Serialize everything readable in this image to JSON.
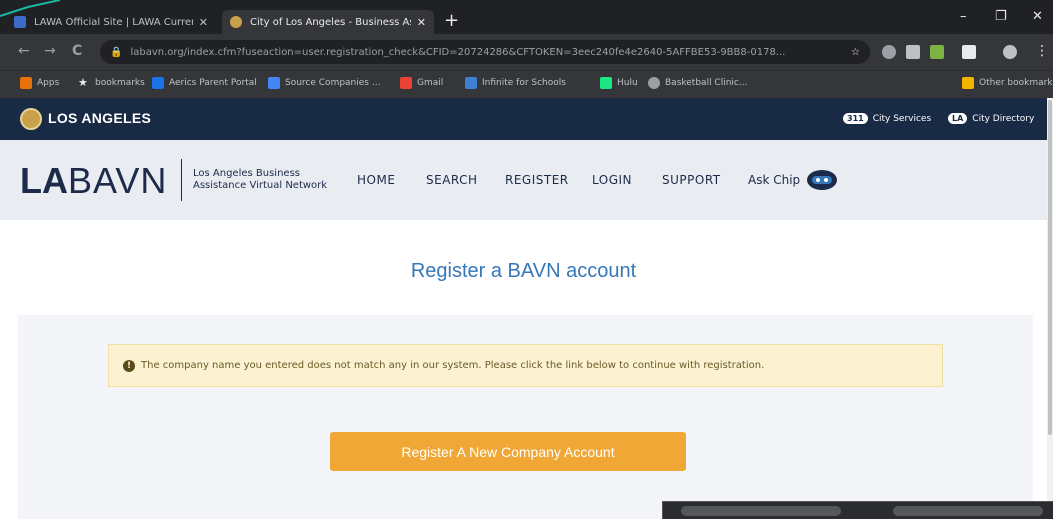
{
  "browser": {
    "tabs": [
      {
        "title": "LAWA Official Site | LAWA Current...",
        "active": false,
        "favicon_color": "#3b6ac9"
      },
      {
        "title": "City of Los Angeles - Business Ass...",
        "active": true,
        "favicon_color": "#c9a14a"
      }
    ],
    "new_tab": "+",
    "window_controls": {
      "minimize": "–",
      "maximize": "❐",
      "close": "✕"
    },
    "nav": {
      "back": "←",
      "forward": "→",
      "reload": "C"
    },
    "url": "labavn.org/index.cfm?fuseaction=user.registration_check&CFID=20724286&CFTOKEN=3eec240fe4e2640-5AFFBE53-9BB8-0178...",
    "bookmarks": [
      {
        "label": "Apps",
        "color": "#e8710a"
      },
      {
        "label": "bookmarks",
        "color": "#e8eaed"
      },
      {
        "label": "Aerics Parent Portal",
        "color": "#1a73e8"
      },
      {
        "label": "Source Companies ...",
        "color": "#4285f4"
      },
      {
        "label": "Gmail",
        "color": "#ea4335"
      },
      {
        "label": "Infinite for Schools",
        "color": "#3f7fd6"
      },
      {
        "label": "Hulu",
        "color": "#1ce783"
      },
      {
        "label": "Basketball Clinic...",
        "color": "#9aa0a6"
      },
      {
        "label": "Other bookmarks",
        "color": "#f4b400"
      }
    ]
  },
  "city_header": {
    "name": "LOS ANGELES",
    "links": [
      {
        "badge": "311",
        "label": "City Services"
      },
      {
        "badge": "LA",
        "label": "City Directory"
      }
    ]
  },
  "site_nav": {
    "logo_bold": "LA",
    "logo_light": "BAVN",
    "tagline": "Los Angeles Business Assistance Virtual Network",
    "links": [
      "HOME",
      "SEARCH",
      "REGISTER",
      "LOGIN",
      "SUPPORT",
      "Ask Chip"
    ]
  },
  "main": {
    "title": "Register a BAVN account",
    "alert": "The company name you entered does not match any in our system. Please click the link below to continue with registration.",
    "cta": "Register A New Company Account"
  }
}
